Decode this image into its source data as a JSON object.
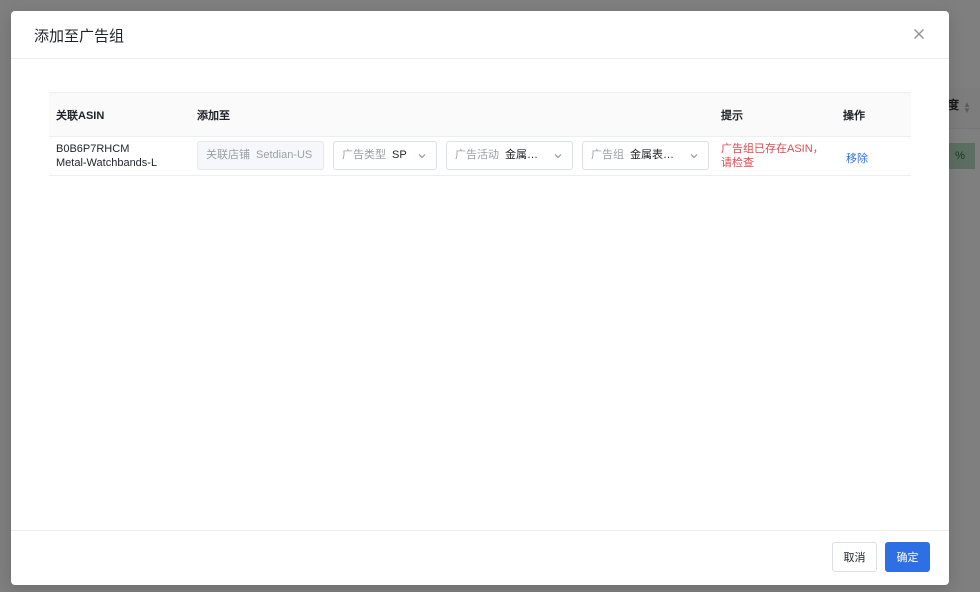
{
  "background": {
    "column_header_fragment": "度",
    "progress_badge": "%"
  },
  "modal": {
    "title": "添加至广告组",
    "close_icon": "close-icon"
  },
  "table": {
    "headers": {
      "asin": "关联ASIN",
      "add_to": "添加至",
      "hint": "提示",
      "action": "操作"
    },
    "rows": [
      {
        "asin": "B0B6P7RHCM",
        "sku": "Metal-Watchbands-L",
        "store": {
          "prefix": "关联店铺",
          "value": "Setdian-US"
        },
        "ad_type": {
          "prefix": "广告类型",
          "value": "SP"
        },
        "campaign": {
          "prefix": "广告活动",
          "value": "金属…"
        },
        "ad_group": {
          "prefix": "广告组",
          "value": "金属表…"
        },
        "hint_line1": "广告组已存在ASIN，",
        "hint_line2": "请检查",
        "action": "移除"
      }
    ]
  },
  "footer": {
    "cancel_label": "取消",
    "confirm_label": "确定"
  },
  "colors": {
    "primary": "#2f6fe4",
    "error": "#e5484d"
  }
}
